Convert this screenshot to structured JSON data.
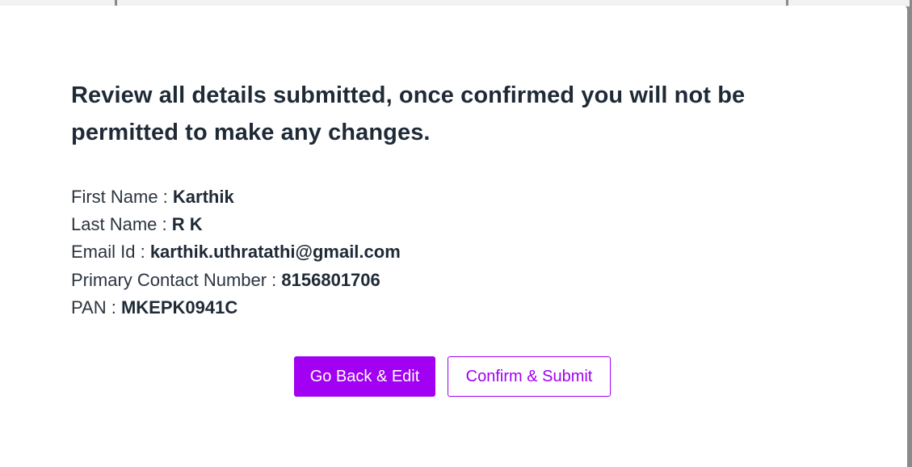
{
  "dialog": {
    "heading": "Review all details submitted, once confirmed you will not be permitted to make any changes.",
    "fields": [
      {
        "label": "First Name : ",
        "value": "Karthik"
      },
      {
        "label": "Last Name : ",
        "value": "R K"
      },
      {
        "label": "Email Id : ",
        "value": "karthik.uthratathi@gmail.com"
      },
      {
        "label": "Primary Contact Number : ",
        "value": "8156801706"
      },
      {
        "label": "PAN : ",
        "value": "MKEPK0941C"
      }
    ],
    "buttons": {
      "back_label": "Go Back & Edit",
      "confirm_label": "Confirm & Submit"
    }
  },
  "colors": {
    "accent": "#a100f2",
    "heading_text": "#1f2a37",
    "overlay": "#8a8a8a"
  }
}
